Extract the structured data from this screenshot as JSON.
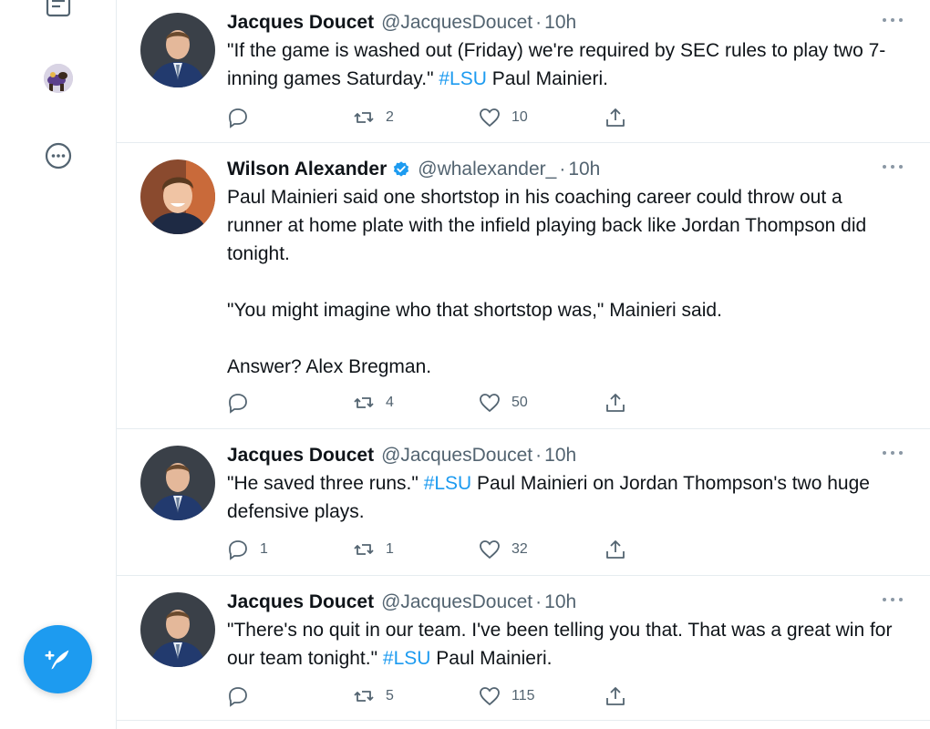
{
  "sidebar": {
    "icons": [
      "lists-icon",
      "profile-avatar",
      "more-icon"
    ],
    "compose_icon": "compose-tweet-icon"
  },
  "tweets": [
    {
      "name": "Jacques Doucet",
      "verified": false,
      "handle": "@JacquesDoucet",
      "dot": "·",
      "time": "10h",
      "text_before": "\"If the game is washed out (Friday) we're required by SEC rules to play two 7-inning games Saturday.\" ",
      "hashtag": "#LSU",
      "text_after": " Paul Mainieri.",
      "replies": "",
      "retweets": "2",
      "likes": "10"
    },
    {
      "name": "Wilson Alexander",
      "verified": true,
      "handle": "@whalexander_",
      "dot": "·",
      "time": "10h",
      "text_before": "Paul Mainieri said one shortstop in his coaching career could throw out a runner at home plate with the infield playing back like Jordan Thompson did tonight.\n\n\"You might imagine who that shortstop was,\" Mainieri said.\n\nAnswer? Alex Bregman.",
      "hashtag": "",
      "text_after": "",
      "replies": "",
      "retweets": "4",
      "likes": "50"
    },
    {
      "name": "Jacques Doucet",
      "verified": false,
      "handle": "@JacquesDoucet",
      "dot": "·",
      "time": "10h",
      "text_before": "\"He saved three runs.\" ",
      "hashtag": "#LSU",
      "text_after": " Paul Mainieri on Jordan Thompson's two huge defensive plays.",
      "replies": "1",
      "retweets": "1",
      "likes": "32"
    },
    {
      "name": "Jacques Doucet",
      "verified": false,
      "handle": "@JacquesDoucet",
      "dot": "·",
      "time": "10h",
      "text_before": "\"There's no quit in our team. I've been telling you that. That was a great win for our team tonight.\" ",
      "hashtag": "#LSU",
      "text_after": " Paul Mainieri.",
      "replies": "",
      "retweets": "5",
      "likes": "115"
    }
  ],
  "colors": {
    "accent": "#1d9bf0",
    "text": "#0f1419",
    "secondary": "#536471",
    "border": "#e6ecf0"
  }
}
